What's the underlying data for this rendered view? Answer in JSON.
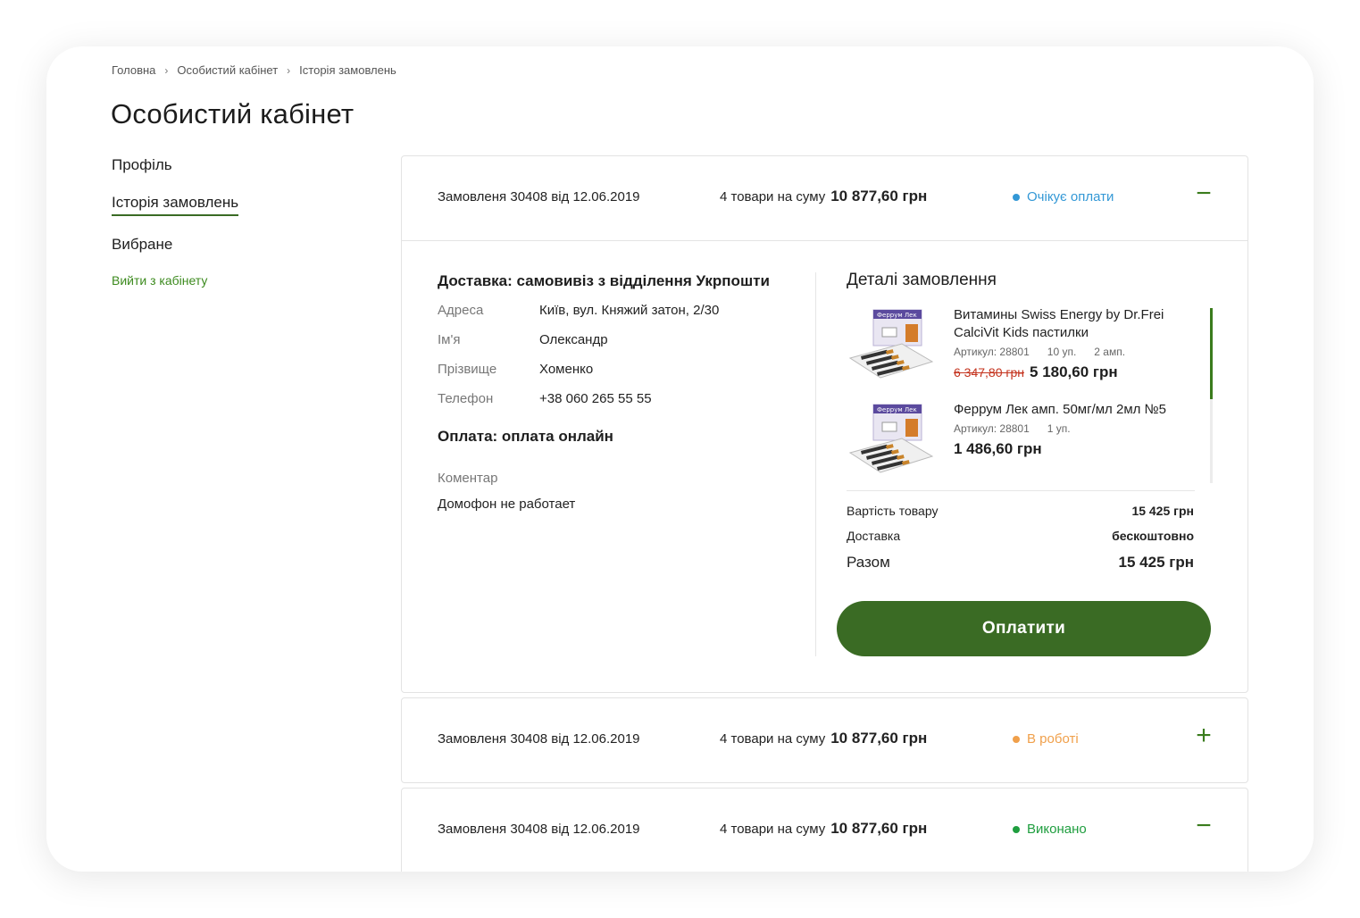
{
  "breadcrumb": {
    "home": "Головна",
    "cabinet": "Особистий кабінет",
    "current": "Історія замовлень"
  },
  "page": {
    "title": "Особистий кабінет"
  },
  "sidebar": {
    "profile": "Профіль",
    "orders": "Історія замовлень",
    "favorites": "Вибране",
    "logout": "Вийти з  кабінету"
  },
  "orders": [
    {
      "number": "Замовленя 30408 від 12.06.2019",
      "sum_label": "4 товари на суму",
      "sum_value": "10 877,60 грн",
      "status": "Очікує оплати",
      "status_color": "#3398d6",
      "toggle": "−",
      "details": {
        "delivery_title": "Доставка: самовивіз з відділення Укрпошти",
        "fields": [
          {
            "label": "Адреса",
            "value": "Київ, вул. Княжий затон, 2/30"
          },
          {
            "label": "Ім'я",
            "value": "Олександр"
          },
          {
            "label": "Прізвище",
            "value": "Хоменко"
          },
          {
            "label": "Телефон",
            "value": "+38 060 265 55 55"
          }
        ],
        "payment_title": "Оплата: оплата онлайн",
        "comment_label": "Коментар",
        "comment_value": "Домофон не работает",
        "order_details_title": "Деталі замовлення",
        "products": [
          {
            "name": "Витамины Swiss Energy by Dr.Frei CalciVit Kids пастилки",
            "article": "Артикул: 28801",
            "qty": "10 уп.",
            "extra": "2 амп.",
            "old_price": "6 347,80 грн",
            "price": "5 180,60 грн"
          },
          {
            "name": "Феррум Лек амп. 50мг/мл 2мл №5",
            "article": "Артикул: 28801",
            "qty": "1 уп.",
            "extra": "",
            "old_price": "",
            "price": "1 486,60 грн"
          }
        ],
        "totals": {
          "goods_label": "Вартість товару",
          "goods_value": "15 425 грн",
          "delivery_label": "Доставка",
          "delivery_value": "бескоштовно",
          "total_label": "Разом",
          "total_value": "15 425 грн"
        },
        "pay_button": "Оплатити",
        "product_box_label": "Феррум Лек"
      }
    },
    {
      "number": "Замовленя 30408 від 12.06.2019",
      "sum_label": "4 товари на суму",
      "sum_value": "10 877,60 грн",
      "status": "В роботі",
      "status_color": "#f0a04b",
      "toggle": "+"
    },
    {
      "number": "Замовленя 30408 від 12.06.2019",
      "sum_label": "4 товари на суму",
      "sum_value": "10 877,60 грн",
      "status": "Виконано",
      "status_color": "#1f9e3f",
      "toggle": "−"
    }
  ],
  "colors": {
    "accent": "#3a6b24",
    "link": "#3c8a1e",
    "danger": "#c4331e"
  }
}
